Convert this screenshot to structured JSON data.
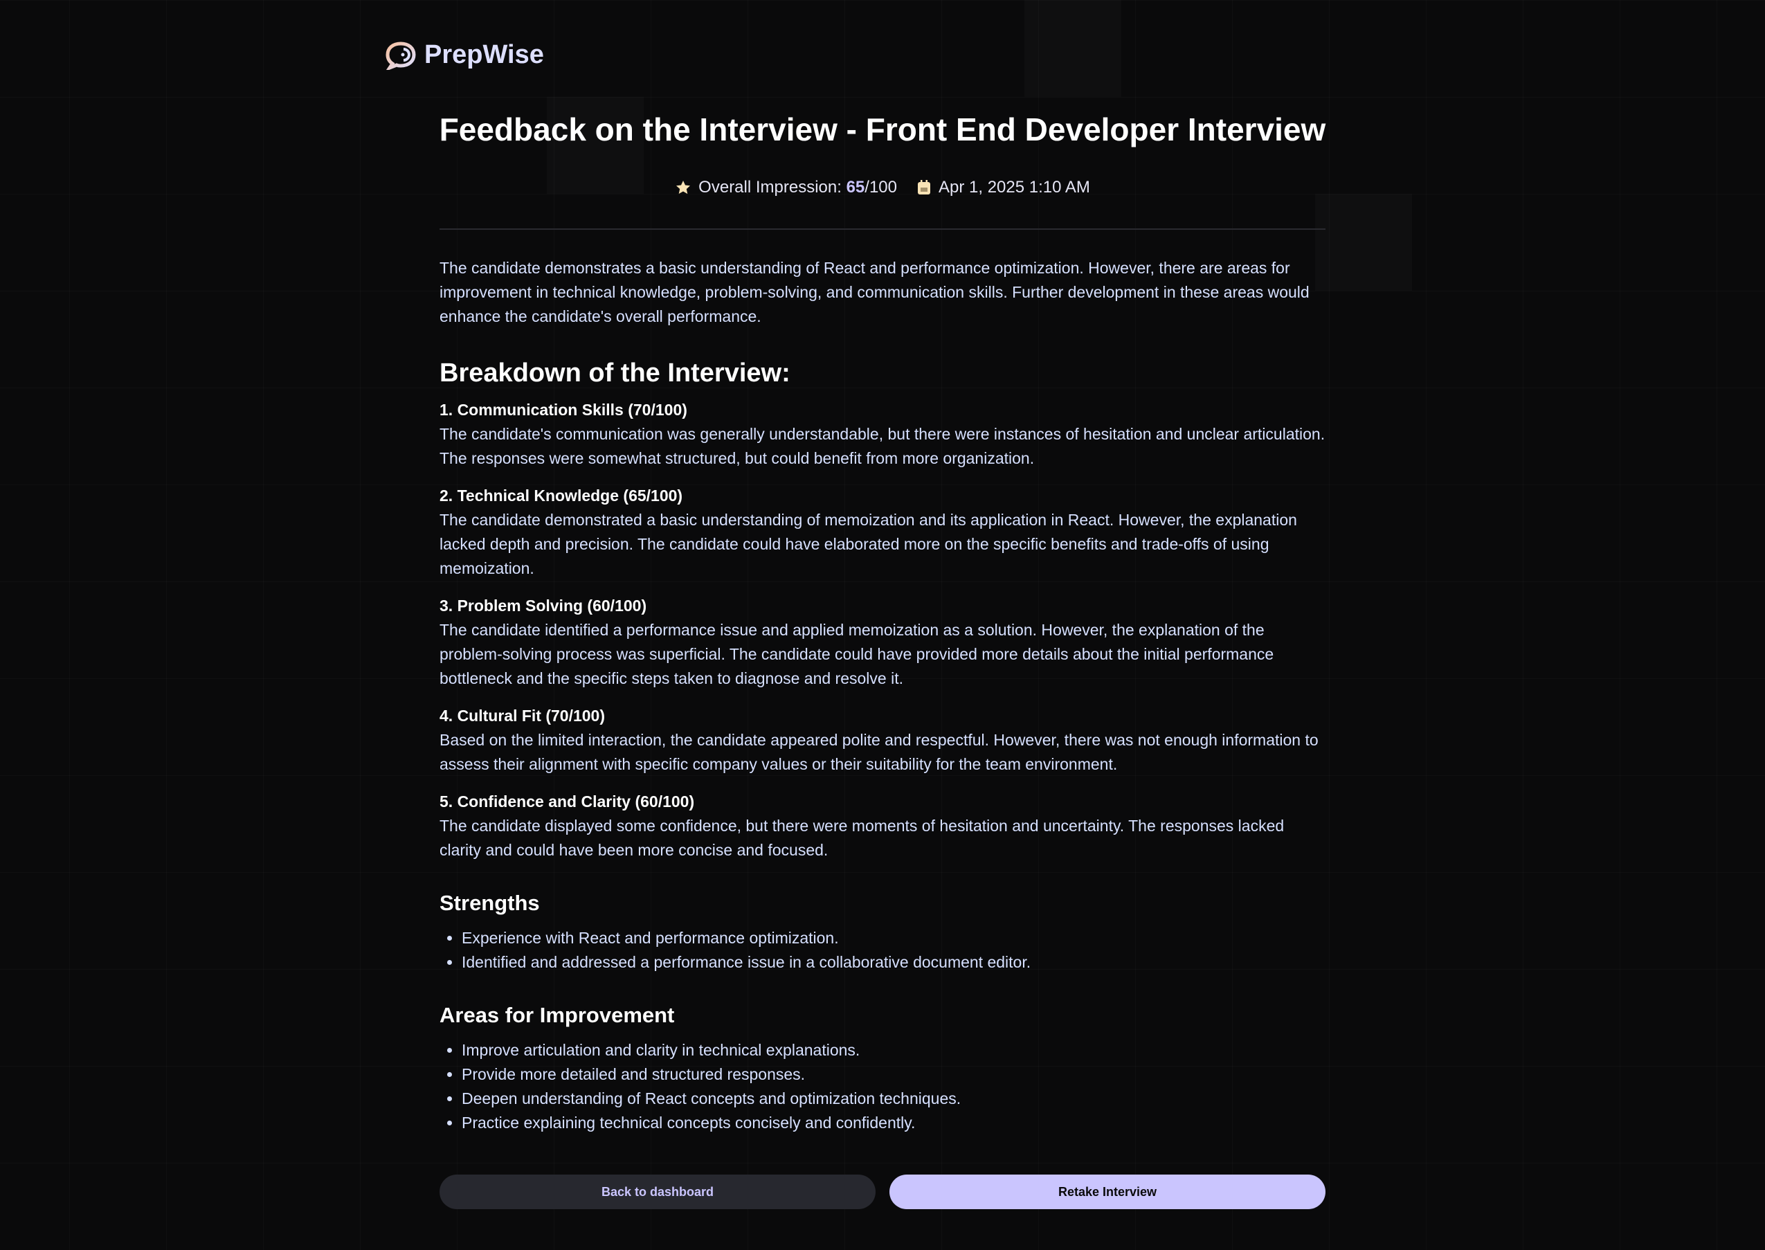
{
  "brand": {
    "name": "PrepWise",
    "icon": "chat-bubble-logo-icon"
  },
  "header": {
    "title": "Feedback on the Interview - Front End Developer Interview",
    "impression_label": "Overall Impression: ",
    "impression_score": "65",
    "impression_max": "/100",
    "date": "Apr 1, 2025 1:10 AM"
  },
  "summary": "The candidate demonstrates a basic understanding of React and performance optimization. However, there are areas for improvement in technical knowledge, problem-solving, and communication skills. Further development in these areas would enhance the candidate's overall performance.",
  "breakdown": {
    "title": "Breakdown of the Interview:",
    "categories": [
      {
        "heading": "1. Communication Skills (70/100)",
        "text": "The candidate's communication was generally understandable, but there were instances of hesitation and unclear articulation. The responses were somewhat structured, but could benefit from more organization."
      },
      {
        "heading": "2. Technical Knowledge (65/100)",
        "text": "The candidate demonstrated a basic understanding of memoization and its application in React. However, the explanation lacked depth and precision. The candidate could have elaborated more on the specific benefits and trade-offs of using memoization."
      },
      {
        "heading": "3. Problem Solving (60/100)",
        "text": "The candidate identified a performance issue and applied memoization as a solution. However, the explanation of the problem-solving process was superficial. The candidate could have provided more details about the initial performance bottleneck and the specific steps taken to diagnose and resolve it."
      },
      {
        "heading": "4. Cultural Fit (70/100)",
        "text": "Based on the limited interaction, the candidate appeared polite and respectful. However, there was not enough information to assess their alignment with specific company values or their suitability for the team environment."
      },
      {
        "heading": "5. Confidence and Clarity (60/100)",
        "text": "The candidate displayed some confidence, but there were moments of hesitation and uncertainty. The responses lacked clarity and could have been more concise and focused."
      }
    ]
  },
  "strengths": {
    "title": "Strengths",
    "items": [
      "Experience with React and performance optimization.",
      "Identified and addressed a performance issue in a collaborative document editor."
    ]
  },
  "improvements": {
    "title": "Areas for Improvement",
    "items": [
      "Improve articulation and clarity in technical explanations.",
      "Provide more detailed and structured responses.",
      "Deepen understanding of React concepts and optimization techniques.",
      "Practice explaining technical concepts concisely and confidently."
    ]
  },
  "actions": {
    "back": "Back to dashboard",
    "retake": "Retake Interview"
  },
  "colors": {
    "background": "#0a0a0b",
    "accent": "#cac5fe",
    "text": "#d6e0ff",
    "button_dark": "#27282f"
  }
}
